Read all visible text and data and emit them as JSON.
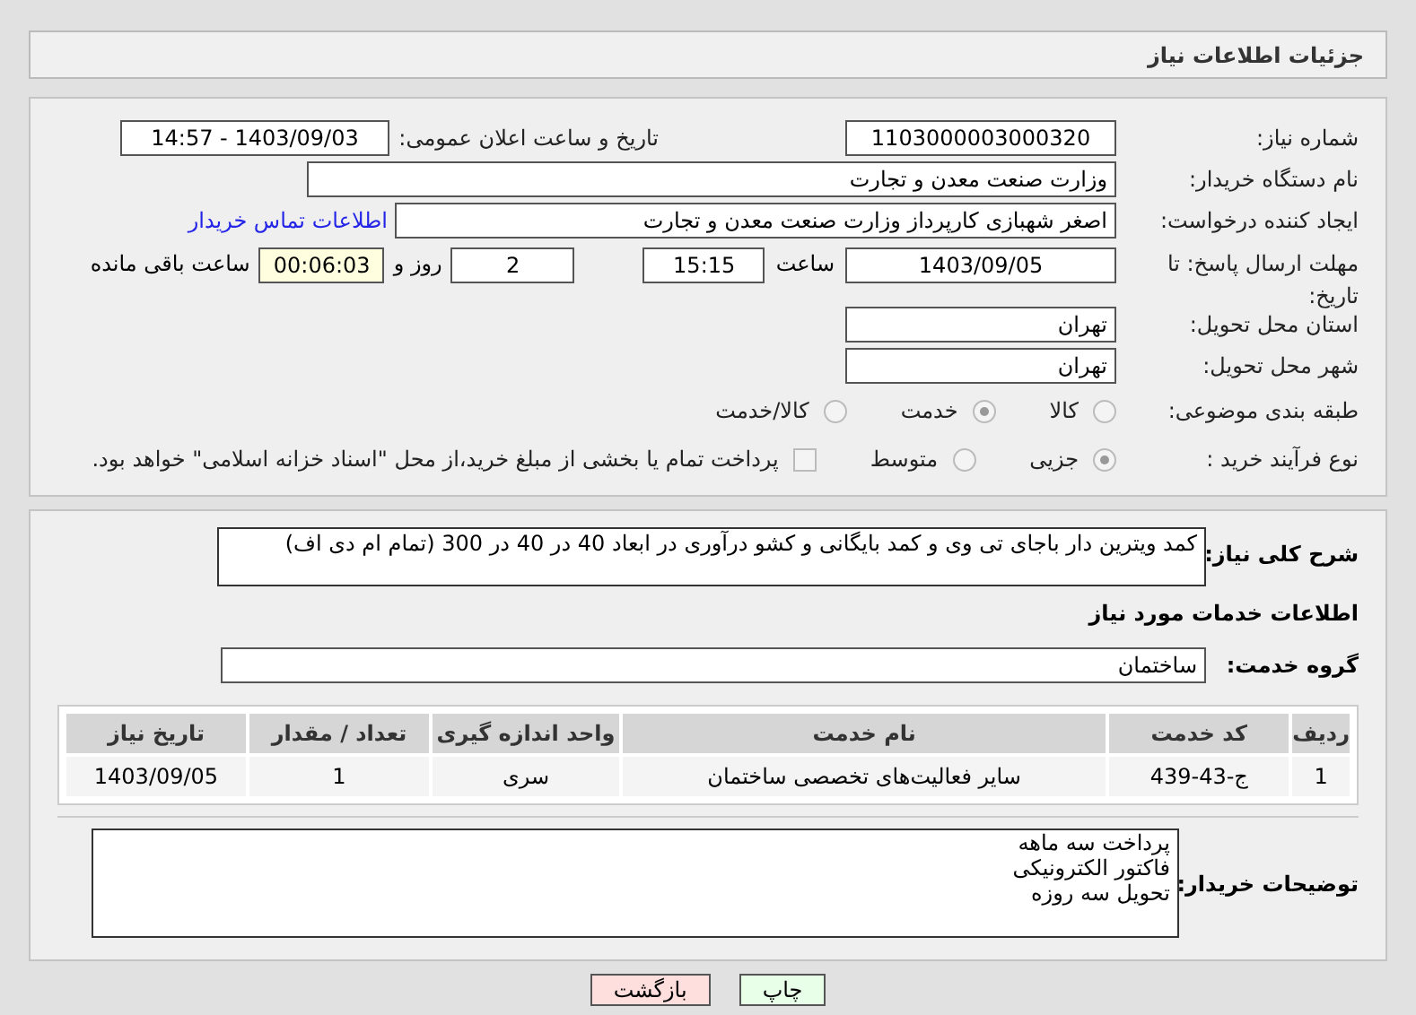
{
  "header": {
    "title": "جزئیات اطلاعات نیاز"
  },
  "need_number": {
    "label": "شماره نیاز:",
    "value": "1103000003000320"
  },
  "announce": {
    "label": "تاریخ و ساعت اعلان عمومی:",
    "value": "1403/09/03 - 14:57"
  },
  "buyer_org": {
    "label": "نام دستگاه خریدار:",
    "value": "وزارت صنعت معدن و تجارت"
  },
  "creator": {
    "label": "ایجاد کننده درخواست:",
    "value": "اصغر شهبازی کارپرداز وزارت صنعت معدن و تجارت",
    "link": "اطلاعات تماس خریدار"
  },
  "deadline": {
    "label": "مهلت ارسال پاسخ: تا تاریخ:",
    "date": "1403/09/05",
    "time_label": "ساعت",
    "time": "15:15",
    "days": "2",
    "days_label": "روز و",
    "remaining": "00:06:03",
    "remaining_label": "ساعت باقی مانده"
  },
  "province": {
    "label": "استان محل تحویل:",
    "value": "تهران"
  },
  "city": {
    "label": "شهر محل تحویل:",
    "value": "تهران"
  },
  "category": {
    "label": "طبقه بندی موضوعی:",
    "options": [
      {
        "label": "کالا",
        "selected": false
      },
      {
        "label": "خدمت",
        "selected": true
      },
      {
        "label": "کالا/خدمت",
        "selected": false
      }
    ]
  },
  "process": {
    "label": "نوع فرآیند خرید :",
    "options": [
      {
        "label": "جزیی",
        "selected": true
      },
      {
        "label": "متوسط",
        "selected": false
      }
    ],
    "payment": {
      "checked": false,
      "label": "پرداخت تمام یا بخشی از مبلغ خرید،از محل \"اسناد خزانه اسلامی\" خواهد بود."
    }
  },
  "description": {
    "label": "شرح کلی نیاز:",
    "value": "کمد ویترین دار باجای تی وی و کمد بایگانی و کشو درآوری در ابعاد 40 در 40 در 300 (تمام ام دی اف)"
  },
  "services_title": "اطلاعات خدمات مورد نیاز",
  "service_group": {
    "label": "گروه خدمت:",
    "value": "ساختمان"
  },
  "table": {
    "columns": [
      "ردیف",
      "کد خدمت",
      "نام خدمت",
      "واحد اندازه گیری",
      "تعداد / مقدار",
      "تاریخ نیاز"
    ],
    "rows": [
      [
        "1",
        "ج-43-439",
        "سایر فعالیت‌های تخصصی ساختمان",
        "سری",
        "1",
        "1403/09/05"
      ]
    ]
  },
  "buyer_notes": {
    "label": "توضیحات خریدار:",
    "lines": [
      "پرداخت سه ماهه",
      "فاکتور الکترونیکی",
      "تحویل سه روزه"
    ]
  },
  "buttons": [
    {
      "label": "چاپ",
      "kind": "print"
    },
    {
      "label": "بازگشت",
      "kind": "back"
    }
  ]
}
